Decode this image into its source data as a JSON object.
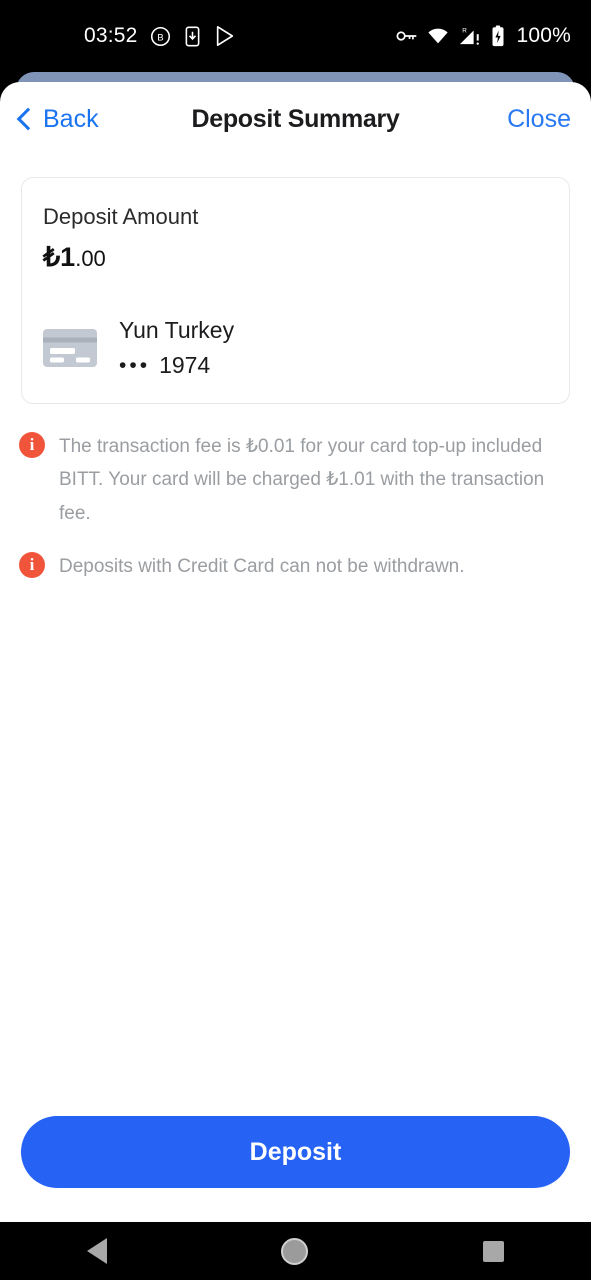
{
  "status_bar": {
    "time": "03:52",
    "left_icons": [
      "circled-b-icon",
      "phone-download-icon",
      "play-store-icon"
    ],
    "right_icons": [
      "vpn-key-icon",
      "wifi-icon",
      "cellular-roaming-icon",
      "battery-charging-icon"
    ],
    "battery": "100%"
  },
  "header": {
    "back_label": "Back",
    "title": "Deposit Summary",
    "close_label": "Close"
  },
  "summary_card": {
    "amount_label": "Deposit Amount",
    "amount_main": "₺1",
    "amount_cents": ".00",
    "method": {
      "icon": "credit-card-icon",
      "name": "Yun Turkey",
      "mask_dots": "•••",
      "last4": "1974"
    }
  },
  "notes": [
    {
      "icon": "info-icon",
      "text": "The transaction fee is ₺0.01 for your card top-up included BITT. Your card will be charged ₺1.01 with the transaction fee."
    },
    {
      "icon": "info-icon",
      "text": "Deposits with Credit Card can not be withdrawn."
    }
  ],
  "cta": {
    "label": "Deposit"
  },
  "nav_bar": {
    "back": "nav-back-icon",
    "home": "nav-home-icon",
    "recents": "nav-recents-icon"
  },
  "colors": {
    "accent_blue": "#2663f5",
    "link_blue": "#1a73f0",
    "info_orange": "#f0553c",
    "sheet_back": "#8094b8",
    "muted_text": "#9a9da1"
  }
}
